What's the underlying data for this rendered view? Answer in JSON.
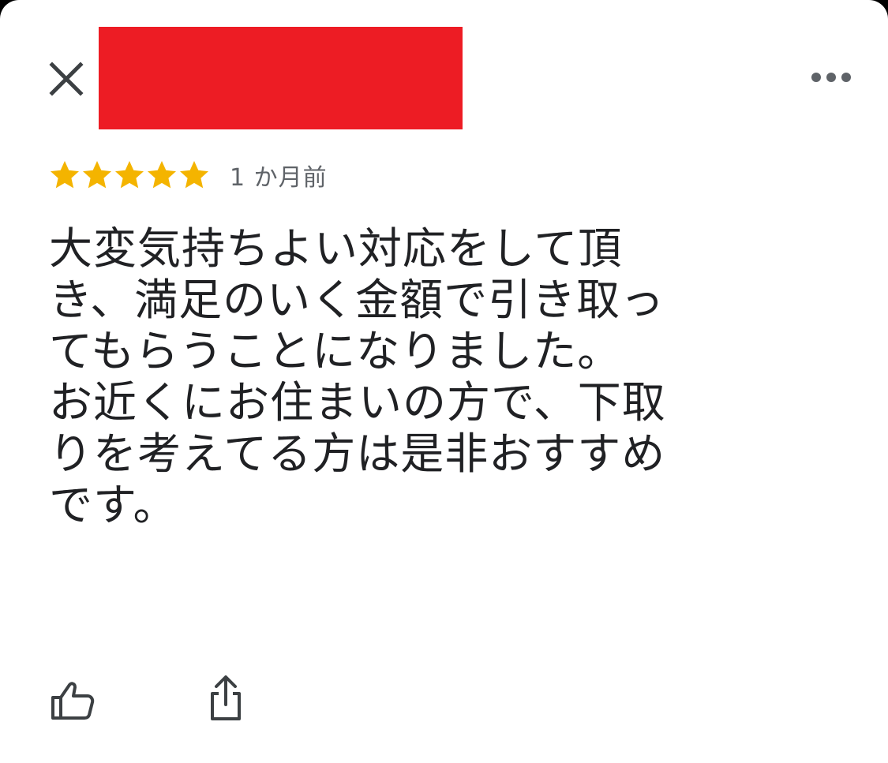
{
  "header": {
    "close_icon": "close-icon",
    "more_icon": "more-horizontal-icon",
    "redaction_color": "#ED1C24"
  },
  "review": {
    "rating": 5,
    "rating_max": 5,
    "star_color": "#F4B400",
    "date": "1 か月前",
    "text": "大変気持ちよい対応をして頂\nき、満足のいく金額で引き取っ\nてもらうことになりました。\nお近くにお住まいの方で、下取\nりを考えてる方は是非おすすめ\nです。"
  },
  "actions": {
    "like_icon": "thumbs-up-icon",
    "share_icon": "share-icon"
  }
}
